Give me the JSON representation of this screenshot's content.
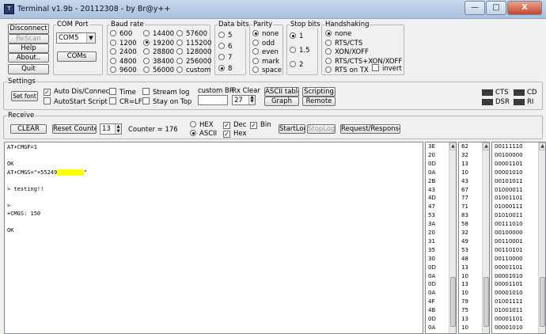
{
  "window": {
    "title": "Terminal v1.9b - 20112308 - by Br@y++",
    "minimize": "—",
    "maximize": "□",
    "close": "X"
  },
  "left_buttons": {
    "disconnect": "Disconnect",
    "rescan": "ReScan",
    "help": "Help",
    "about": "About..",
    "quit": "Quit"
  },
  "com_port": {
    "label": "COM Port",
    "value": "COM5",
    "coms": "COMs"
  },
  "baud": {
    "label": "Baud rate",
    "options": [
      "600",
      "1200",
      "2400",
      "4800",
      "9600",
      "14400",
      "19200",
      "28800",
      "38400",
      "56000",
      "57600",
      "115200",
      "128000",
      "256000",
      "custom"
    ],
    "selected": "19200"
  },
  "data_bits": {
    "label": "Data bits",
    "options": [
      "5",
      "6",
      "7",
      "8"
    ],
    "selected": "8"
  },
  "parity": {
    "label": "Parity",
    "options": [
      "none",
      "odd",
      "even",
      "mark",
      "space"
    ],
    "selected": "none"
  },
  "stop_bits": {
    "label": "Stop bits",
    "options": [
      "1",
      "1.5",
      "2"
    ],
    "selected": "1"
  },
  "handshaking": {
    "label": "Handshaking",
    "options": [
      "none",
      "RTS/CTS",
      "XON/XOFF",
      "RTS/CTS+XON/XOFF",
      "RTS on TX"
    ],
    "selected": "none",
    "invert": "invert"
  },
  "settings": {
    "label": "Settings",
    "set_font": "Set font",
    "auto_dis_connect": "Auto Dis/Connect",
    "autostart_script": "AutoStart Script",
    "time": "Time",
    "cr_lf": "CR=LF",
    "stream_log": "Stream log",
    "stay_on_top": "Stay on Top",
    "custom_br": "custom BR",
    "rx_clear": "Rx Clear",
    "rx_clear_value": "27",
    "ascii_table": "ASCII table",
    "graph": "Graph",
    "scripting": "Scripting",
    "remote": "Remote",
    "cts": "CTS",
    "cd": "CD",
    "dsr": "DSR",
    "ri": "RI"
  },
  "receive": {
    "label": "Receive",
    "clear": "CLEAR",
    "reset_counter": "Reset Counter",
    "counter_input": "13",
    "counter": "Counter = 176",
    "hex": "HEX",
    "ascii": "ASCII",
    "dec": "Dec",
    "hex_chk": "Hex",
    "bin": "Bin",
    "startlog": "StartLog",
    "stoplog": "StopLog",
    "request_response": "Request/Response"
  },
  "terminal": {
    "lines": [
      "AT+CMGF=1",
      "",
      "OK",
      "AT+CMGS=\"+55249",
      "",
      "> testing!!",
      "",
      "> ",
      "+CMGS: 150",
      "",
      "OK"
    ],
    "redacted": "XXXXXXXX",
    "after_redacted": "\""
  },
  "hex_col": [
    "3E",
    "20",
    "0D",
    "0A",
    "2B",
    "43",
    "4D",
    "47",
    "53",
    "3A",
    "20",
    "31",
    "35",
    "30",
    "0D",
    "0A",
    "0D",
    "0A",
    "4F",
    "4B",
    "0D",
    "0A"
  ],
  "dec_col": [
    "62",
    "32",
    "13",
    "10",
    "43",
    "67",
    "77",
    "71",
    "83",
    "58",
    "32",
    "49",
    "53",
    "48",
    "13",
    "10",
    "13",
    "10",
    "79",
    "75",
    "13",
    "10"
  ],
  "bin_col": [
    "00111110",
    "00100000",
    "00001101",
    "00001010",
    "00101011",
    "01000011",
    "01001101",
    "01000111",
    "01010011",
    "00111010",
    "00100000",
    "00110001",
    "00110101",
    "00110000",
    "00001101",
    "00001010",
    "00001101",
    "00001010",
    "01001111",
    "01001011",
    "00001101",
    "00001010"
  ]
}
